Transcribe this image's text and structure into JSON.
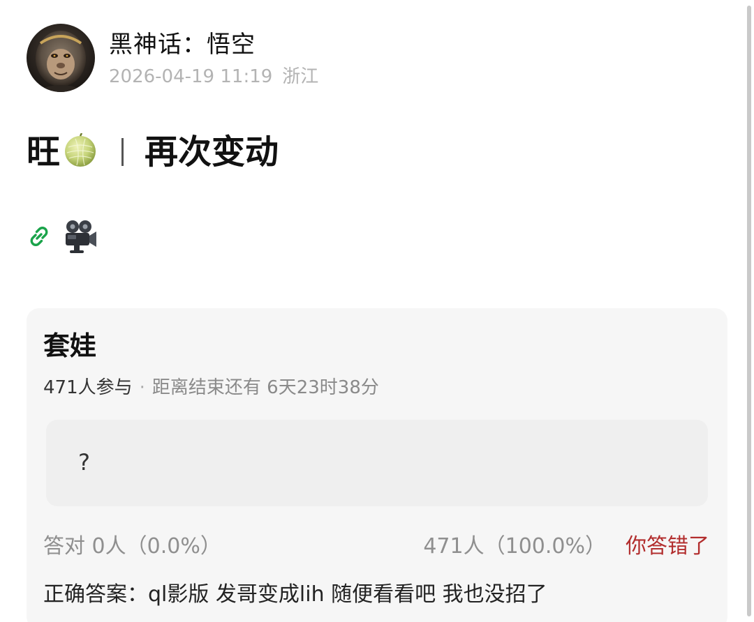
{
  "author": {
    "name": "黑神话：悟空",
    "date": "2026-04-19 11:19",
    "location": "浙江",
    "avatar_icon": "wukong-avatar"
  },
  "post": {
    "title_prefix": "旺",
    "title_emoji_icon": "melon-emoji-icon",
    "title_main": "再次变动",
    "media_icons": [
      "link-icon",
      "movie-camera-icon"
    ]
  },
  "poll": {
    "title": "套娃",
    "participants": "471人参与",
    "separator": "·",
    "deadline": "距离结束还有 6天23时38分",
    "question": "?",
    "correct_result": "答对  0人（0.0%）",
    "wrong_result": "471人（100.0%）",
    "wrong_label": "你答错了",
    "answer": "正确答案：ql影版 发哥变成lih 随便看看吧 我也没招了"
  },
  "colors": {
    "wrong_red": "#b22d2d",
    "link_green": "#1aa34a",
    "card_bg": "#f6f6f6"
  }
}
